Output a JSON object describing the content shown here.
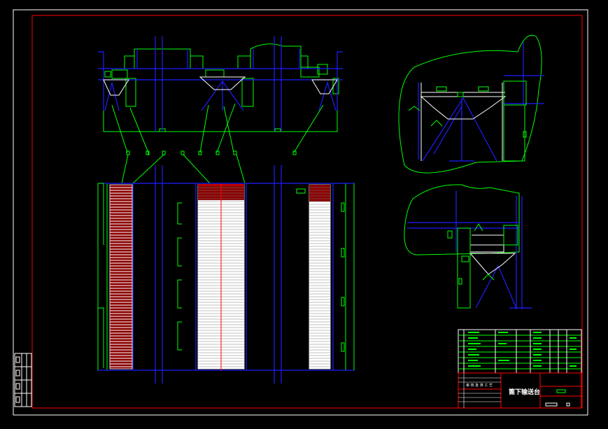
{
  "drawing": {
    "colors": {
      "background": "#000000",
      "outer_frame": "#ffffff",
      "inner_frame": "#ff0000",
      "structure": "#1e1eff",
      "outline": "#00ff00",
      "leader": "#00ff00",
      "steel": "#ffffff",
      "section": "#ff0000",
      "grid": "#1e1eff",
      "red_line": "#ff0000"
    },
    "views": {
      "front_elevation": {
        "icon": "front-elevation-view"
      },
      "plan_view": {
        "icon": "plan-view"
      },
      "side_section_a": {
        "icon": "side-section-view"
      },
      "side_section_b": {
        "icon": "side-section-view"
      }
    },
    "title_block": {
      "drawing_title": "篦下输送台",
      "signature_marks": "审 核 批 准 工 艺"
    }
  }
}
